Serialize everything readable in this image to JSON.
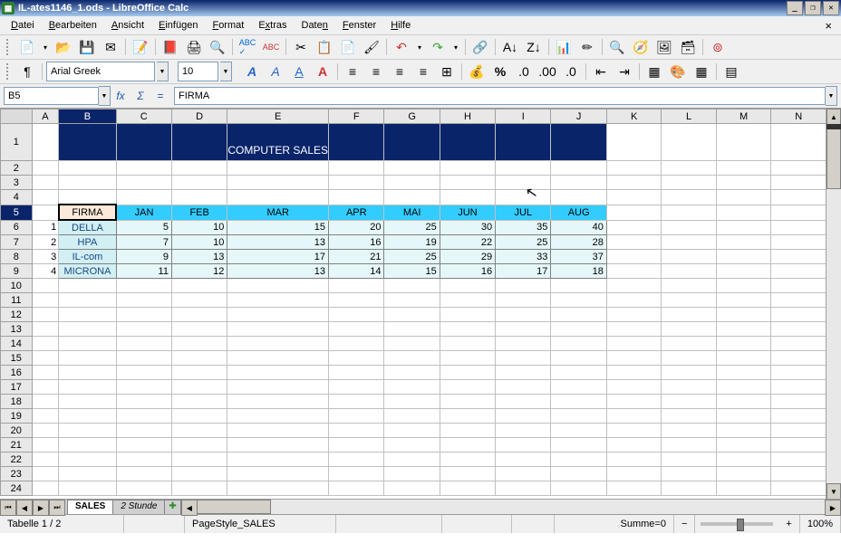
{
  "window": {
    "title": "IL-ates1146_1.ods - LibreOffice Calc"
  },
  "menu": {
    "items": [
      "Datei",
      "Bearbeiten",
      "Ansicht",
      "Einfügen",
      "Format",
      "Extras",
      "Daten",
      "Fenster",
      "Hilfe"
    ]
  },
  "format_toolbar": {
    "font_name": "Arial Greek",
    "font_size": "10"
  },
  "formula_bar": {
    "cell_ref": "B5",
    "content": "FIRMA"
  },
  "sheet": {
    "columns": [
      "A",
      "B",
      "C",
      "D",
      "E",
      "F",
      "G",
      "H",
      "I",
      "J",
      "K",
      "L",
      "M",
      "N"
    ],
    "active_col": "B",
    "active_row": 5,
    "title": "COMPUTER SALES",
    "header_row": {
      "firma": "FIRMA",
      "months": [
        "JAN",
        "FEB",
        "MAR",
        "APR",
        "MAI",
        "JUN",
        "JUL",
        "AUG"
      ]
    },
    "data_rows": [
      {
        "idx": "1",
        "company": "DELLA",
        "v": [
          5,
          10,
          15,
          20,
          25,
          30,
          35,
          40
        ]
      },
      {
        "idx": "2",
        "company": "HPA",
        "v": [
          7,
          10,
          13,
          16,
          19,
          22,
          25,
          28
        ]
      },
      {
        "idx": "3",
        "company": "IL-com",
        "v": [
          9,
          13,
          17,
          21,
          25,
          29,
          33,
          37
        ]
      },
      {
        "idx": "4",
        "company": "MICRONA",
        "v": [
          11,
          12,
          13,
          14,
          15,
          16,
          17,
          18
        ]
      }
    ],
    "row_numbers": [
      1,
      2,
      3,
      4,
      5,
      6,
      7,
      8,
      9,
      10,
      11,
      12,
      13,
      14,
      15,
      16,
      17,
      18,
      19,
      20,
      21,
      22,
      23,
      24
    ]
  },
  "tabs": {
    "sheets": [
      "SALES",
      "2 Stunde"
    ],
    "active": 0
  },
  "status": {
    "sheet_pos": "Tabelle 1 / 2",
    "page_style": "PageStyle_SALES",
    "sum": "Summe=0",
    "zoom_minus": "−",
    "zoom_plus": "+",
    "zoom": "100%"
  },
  "icons": {
    "bold": "A",
    "italic": "A",
    "underline": "A",
    "fx": "fx",
    "sigma": "Σ",
    "eq": "="
  }
}
